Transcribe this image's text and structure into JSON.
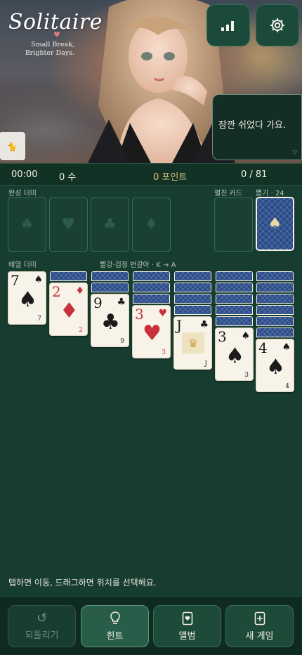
{
  "header": {
    "logo_title": "Solitaire",
    "logo_sub_1": "Small Break,",
    "logo_sub_2": "Brighter Days.",
    "speech_text": "잠깐 쉬었다 가요."
  },
  "stats": {
    "time": "00:00",
    "moves": "0 수",
    "points": "0 포인트",
    "progress": "0 / 81"
  },
  "labels": {
    "foundation": "완성 더미",
    "waste": "펼친 카드",
    "stock": "뽑기 · 24",
    "tableau": "배열 더미",
    "rule": "빨강·검정 번갈아 · K → A"
  },
  "foundation_suits": [
    "♠",
    "♥",
    "♣",
    "♦"
  ],
  "tableau": [
    {
      "rank": "7",
      "suit": "♠",
      "color": "black",
      "small_rank": "7"
    },
    {
      "rank": "2",
      "suit": "♦",
      "color": "red",
      "small_rank": "2"
    },
    {
      "rank": "9",
      "suit": "♣",
      "color": "black",
      "small_rank": "9"
    },
    {
      "rank": "3",
      "suit": "♥",
      "color": "red",
      "small_rank": "3"
    },
    {
      "rank": "J",
      "suit": "♣",
      "color": "black",
      "small_rank": "J"
    },
    {
      "rank": "3",
      "suit": "♠",
      "color": "black",
      "small_rank": "3"
    },
    {
      "rank": "4",
      "suit": "♠",
      "color": "black",
      "small_rank": "4"
    }
  ],
  "hint_text": "탭하면 이동, 드래그하면 위치를 선택해요.",
  "bottom": {
    "undo": "되돌리기",
    "hint": "힌트",
    "album": "앨범",
    "new_game": "새 게임"
  },
  "colors": {
    "table": "#173d30",
    "card_back": "#2b4c8a",
    "points": "#d7c27a"
  }
}
